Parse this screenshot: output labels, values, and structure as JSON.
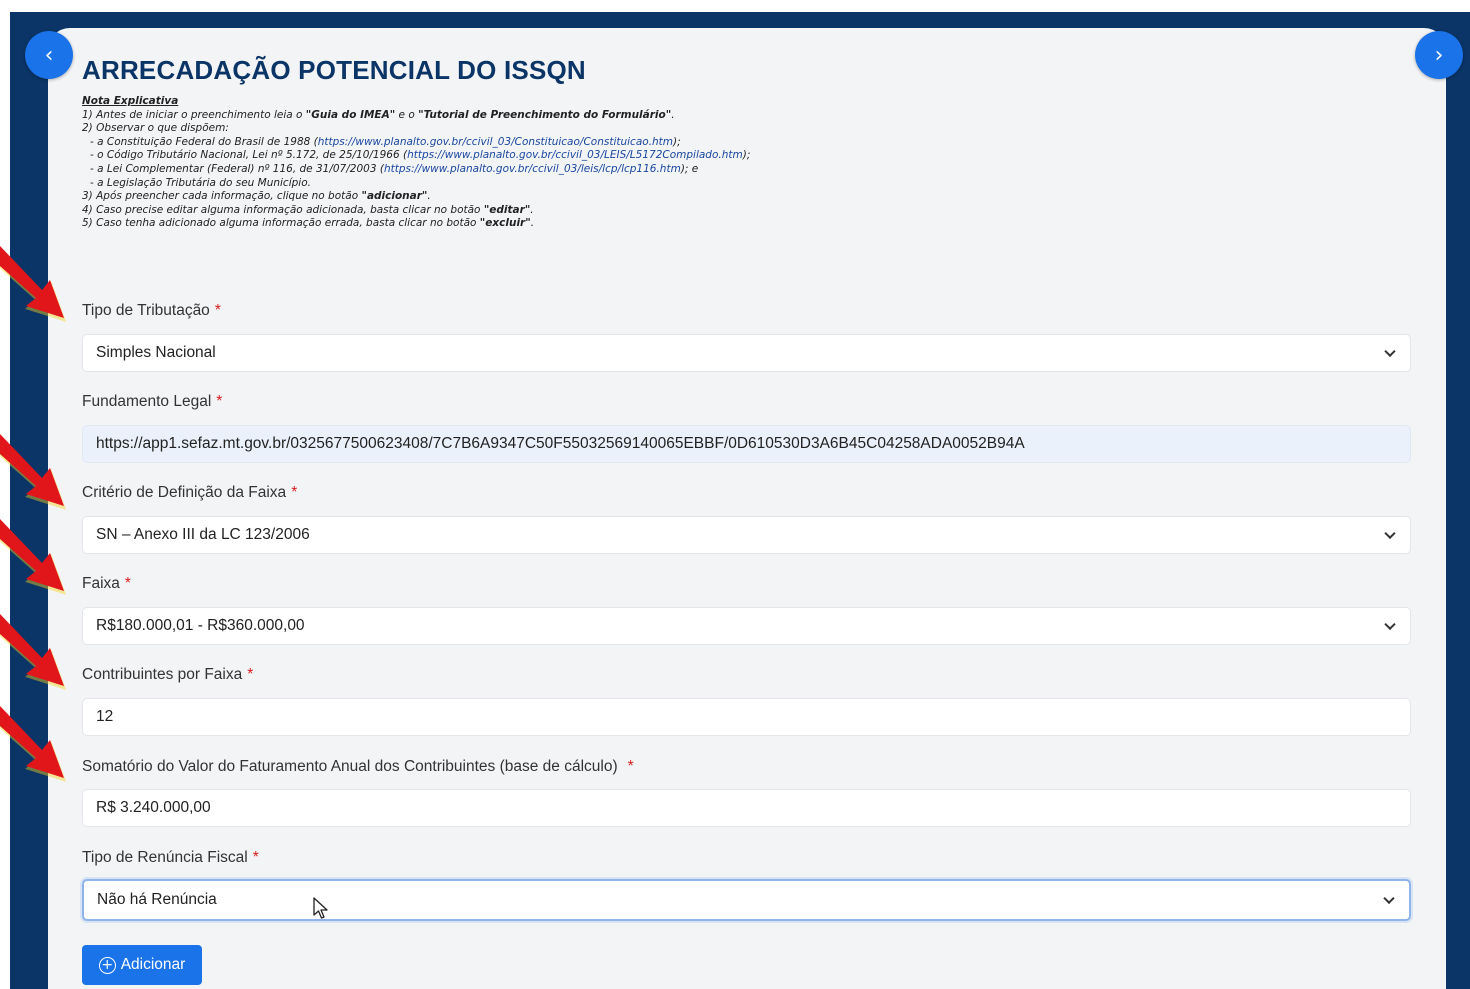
{
  "form": {
    "title": "ARRECADAÇÃO POTENCIAL DO ISSQN",
    "notes": {
      "heading": "Nota Explicativa",
      "line1_a": "1) Antes de iniciar o preenchimento leia o ",
      "line1_b": "\"Guia do IMEA\"",
      "line1_c": " e o ",
      "line1_d": "\"Tutorial de Preenchimento do Formulário\"",
      "line1_e": ".",
      "line2": "2) Observar o que dispõem:",
      "cf_text": "- a Constituição Federal do Brasil de 1988 (",
      "cf_link": "https://www.planalto.gov.br/ccivil_03/Constituicao/Constituicao.htm",
      "cf_end": ");",
      "ctn_text": "- o Código Tributário Nacional, Lei nº 5.172, de 25/10/1966 (",
      "ctn_link": "https://www.planalto.gov.br/ccivil_03/LEIS/L5172Compilado.htm",
      "ctn_end": ");",
      "lc_text": "- a Lei Complementar (Federal) nº 116, de 31/07/2003 (",
      "lc_link": "https://www.planalto.gov.br/ccivil_03/leis/lcp/lcp116.htm",
      "lc_end": "); e",
      "leg": "- a Legislação Tributária do seu Município.",
      "line3_a": "3) Após preencher cada informação, clique no botão ",
      "line3_b": "\"adicionar\"",
      "line3_c": ".",
      "line4_a": "4) Caso precise editar alguma informação adicionada, basta clicar no botão ",
      "line4_b": "\"editar\"",
      "line4_c": ".",
      "line5_a": "5) Caso tenha adicionado alguma informação errada, basta clicar no botão ",
      "line5_b": "\"excluir\"",
      "line5_c": "."
    },
    "required_mark": "*",
    "tipo_tributacao": {
      "label": "Tipo de Tributação",
      "value": "Simples Nacional"
    },
    "fundamento_legal": {
      "label": "Fundamento Legal",
      "value": "https://app1.sefaz.mt.gov.br/0325677500623408/7C7B6A9347C50F55032569140065EBBF/0D610530D3A6B45C04258ADA0052B94A"
    },
    "criterio_faixa": {
      "label": "Critério de Definição da Faixa",
      "value": "SN – Anexo III da LC 123/2006"
    },
    "faixa": {
      "label": "Faixa",
      "value": "R$180.000,01 - R$360.000,00"
    },
    "contribuintes": {
      "label": "Contribuintes por Faixa",
      "value": "12"
    },
    "somatorio": {
      "label": "Somatório do Valor do Faturamento Anual dos Contribuintes (base de cálculo)",
      "value": "R$ 3.240.000,00"
    },
    "renuncia": {
      "label": "Tipo de Renúncia Fiscal",
      "value": "Não há Renúncia"
    },
    "add_label": "Adicionar"
  },
  "colors": {
    "brand_navy": "#0b3566",
    "primary_blue": "#1a73e8",
    "required_red": "#d81b1b",
    "arrow_red": "#e0161b",
    "arrow_glow": "#f2d21a"
  },
  "icons": {
    "prev": "chevron-left-icon",
    "next": "chevron-right-icon",
    "dropdown": "chevron-down-icon",
    "add": "plus-circle-icon",
    "cursor": "mouse-pointer-icon",
    "annotation": "red-arrow-icon"
  }
}
